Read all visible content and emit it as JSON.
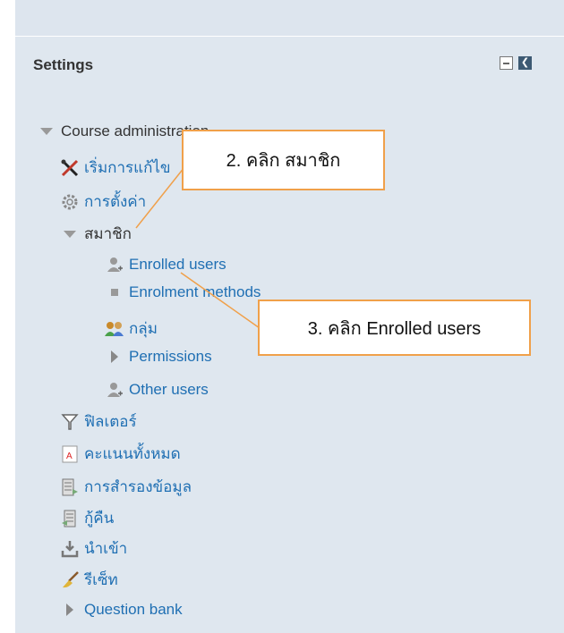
{
  "settings": {
    "title": "Settings",
    "dock_icon": "dock-icon",
    "minimize_icon": "minimize-icon"
  },
  "tree": {
    "course_admin": "Course administration",
    "start_course": "เริ่มการแก้ไข",
    "settings": "การตั้งค่า",
    "members": "สมาชิก",
    "enrolled_users": "Enrolled users",
    "enrolment_methods": "Enrolment methods",
    "groups": "กลุ่ม",
    "permissions": "Permissions",
    "other_users": "Other users",
    "filters": "ฟิลเตอร์",
    "gradebook": "คะแนนทั้งหมด",
    "backup": "การสำรองข้อมูล",
    "restore": "กู้คืน",
    "import": "นำเข้า",
    "reset": "รีเซ็ท",
    "question_bank": "Question bank"
  },
  "callouts": {
    "step2": "2. คลิก สมาชิก",
    "step3": "3. คลิก Enrolled users"
  },
  "colors": {
    "panel_bg": "#dfe7ef",
    "link": "#1f6fb3",
    "callout_border": "#f0a04a"
  }
}
